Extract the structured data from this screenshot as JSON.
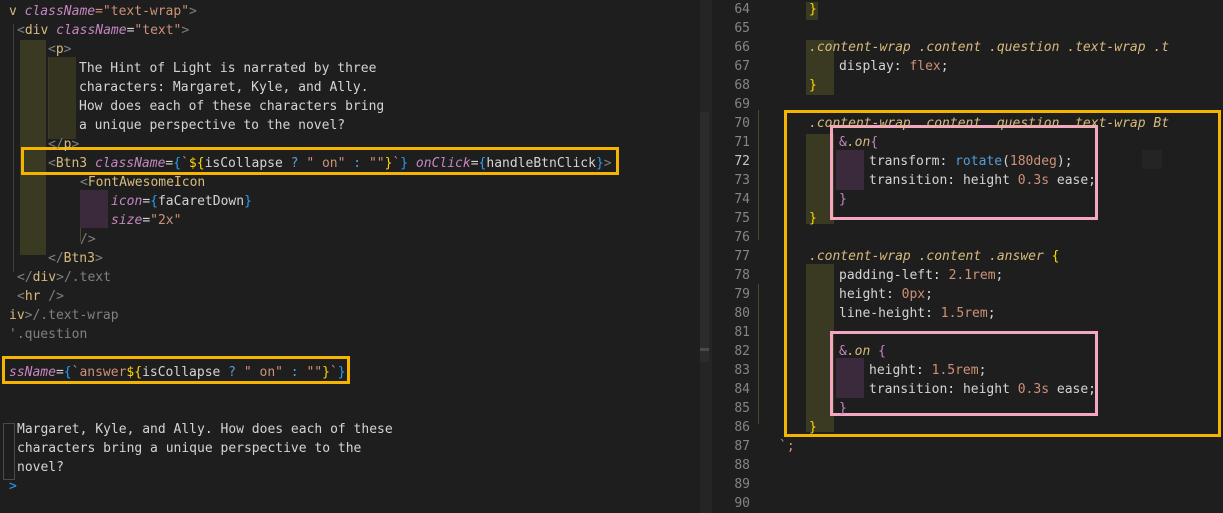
{
  "left": {
    "lines": [
      [
        {
          "t": "v ",
          "c": "tk-tag"
        },
        {
          "t": "className",
          "c": "tk-attr"
        },
        {
          "t": "=\"text-wrap\"",
          "c": "tk-str"
        },
        {
          "t": ">",
          "c": "tk-punc"
        }
      ],
      [
        {
          "t": "<",
          "c": "tk-punc"
        },
        {
          "t": "div",
          "c": "tk-tag"
        },
        {
          "t": " ",
          "c": "tk-txt"
        },
        {
          "t": "className",
          "c": "tk-attr"
        },
        {
          "t": "=",
          "c": "tk-txt"
        },
        {
          "t": "\"text\"",
          "c": "tk-str"
        },
        {
          "t": ">",
          "c": "tk-punc"
        }
      ],
      [
        {
          "t": "<",
          "c": "tk-punc"
        },
        {
          "t": "p",
          "c": "tk-tag"
        },
        {
          "t": ">",
          "c": "tk-punc"
        }
      ],
      [
        {
          "t": "The Hint of Light is narrated by three",
          "c": "tk-txt"
        }
      ],
      [
        {
          "t": "characters: Margaret, Kyle, and Ally.",
          "c": "tk-txt"
        }
      ],
      [
        {
          "t": "How does each of these characters bring",
          "c": "tk-txt"
        }
      ],
      [
        {
          "t": "a unique perspective to the novel?",
          "c": "tk-txt"
        }
      ],
      [
        {
          "t": "</",
          "c": "tk-punc"
        },
        {
          "t": "p",
          "c": "tk-tag"
        },
        {
          "t": ">",
          "c": "tk-punc"
        }
      ],
      [
        {
          "t": "<",
          "c": "tk-punc"
        },
        {
          "t": "Btn3",
          "c": "tk-tag"
        },
        {
          "t": " ",
          "c": "tk-txt"
        },
        {
          "t": "className",
          "c": "tk-attr"
        },
        {
          "t": "=",
          "c": "tk-txt"
        },
        {
          "t": "{",
          "c": "tk-br"
        },
        {
          "t": "`",
          "c": "tk-str"
        },
        {
          "t": "${",
          "c": "tk-yel"
        },
        {
          "t": "isCollapse",
          "c": "tk-txt"
        },
        {
          "t": " ? ",
          "c": "tk-kw"
        },
        {
          "t": "\" on\"",
          "c": "tk-str"
        },
        {
          "t": " : ",
          "c": "tk-kw"
        },
        {
          "t": "\"\"",
          "c": "tk-str"
        },
        {
          "t": "}",
          "c": "tk-yel"
        },
        {
          "t": "`",
          "c": "tk-str"
        },
        {
          "t": "}",
          "c": "tk-br"
        },
        {
          "t": " ",
          "c": "tk-txt"
        },
        {
          "t": "onClick",
          "c": "tk-attr"
        },
        {
          "t": "=",
          "c": "tk-txt"
        },
        {
          "t": "{",
          "c": "tk-br"
        },
        {
          "t": "handleBtnClick",
          "c": "tk-txt"
        },
        {
          "t": "}",
          "c": "tk-br"
        },
        {
          "t": ">",
          "c": "tk-punc"
        }
      ],
      [
        {
          "t": "<",
          "c": "tk-punc"
        },
        {
          "t": "FontAwesomeIcon",
          "c": "tk-tag"
        }
      ],
      [
        {
          "t": "icon",
          "c": "tk-attr"
        },
        {
          "t": "=",
          "c": "tk-txt"
        },
        {
          "t": "{",
          "c": "tk-br"
        },
        {
          "t": "faCaretDown",
          "c": "tk-txt"
        },
        {
          "t": "}",
          "c": "tk-br"
        }
      ],
      [
        {
          "t": "size",
          "c": "tk-attr"
        },
        {
          "t": "=",
          "c": "tk-txt"
        },
        {
          "t": "\"2x\"",
          "c": "tk-str"
        }
      ],
      [
        {
          "t": "/>",
          "c": "tk-punc"
        }
      ],
      [
        {
          "t": "</",
          "c": "tk-punc"
        },
        {
          "t": "Btn3",
          "c": "tk-tag"
        },
        {
          "t": ">",
          "c": "tk-punc"
        }
      ],
      [
        {
          "t": "</",
          "c": "tk-punc"
        },
        {
          "t": "div",
          "c": "tk-tag"
        },
        {
          "t": ">",
          "c": "tk-punc"
        },
        {
          "t": "/.text",
          "c": "tk-com"
        }
      ],
      [
        {
          "t": "<",
          "c": "tk-punc"
        },
        {
          "t": "hr",
          "c": "tk-tag"
        },
        {
          "t": " />",
          "c": "tk-punc"
        }
      ],
      [
        {
          "t": "iv",
          "c": "tk-tag"
        },
        {
          "t": ">",
          "c": "tk-punc"
        },
        {
          "t": "/.text-wrap",
          "c": "tk-com"
        }
      ],
      [
        {
          "t": "'.question",
          "c": "tk-com"
        }
      ],
      [
        {
          "t": "",
          "c": "tk-txt"
        }
      ],
      [
        {
          "t": "ssName",
          "c": "tk-attr"
        },
        {
          "t": "=",
          "c": "tk-txt"
        },
        {
          "t": "{",
          "c": "tk-br"
        },
        {
          "t": "`",
          "c": "tk-str"
        },
        {
          "t": "answer",
          "c": "tk-str"
        },
        {
          "t": "${",
          "c": "tk-yel"
        },
        {
          "t": "isCollapse",
          "c": "tk-txt"
        },
        {
          "t": " ? ",
          "c": "tk-kw"
        },
        {
          "t": "\" on\"",
          "c": "tk-str"
        },
        {
          "t": " : ",
          "c": "tk-kw"
        },
        {
          "t": "\"\"",
          "c": "tk-str"
        },
        {
          "t": "}",
          "c": "tk-yel"
        },
        {
          "t": "`",
          "c": "tk-str"
        },
        {
          "t": "}",
          "c": "tk-br"
        }
      ],
      [
        {
          "t": "",
          "c": "tk-txt"
        }
      ],
      [
        {
          "t": "",
          "c": "tk-txt"
        }
      ],
      [
        {
          "t": "Margaret, Kyle, and Ally. How does each of these",
          "c": "tk-txt"
        }
      ],
      [
        {
          "t": "characters bring a unique perspective to the",
          "c": "tk-txt"
        }
      ],
      [
        {
          "t": "novel?",
          "c": "tk-txt"
        }
      ],
      [
        {
          "t": ">",
          "c": "tk-br"
        }
      ]
    ]
  },
  "right": {
    "line_numbers": [
      "64",
      "65",
      "66",
      "67",
      "68",
      "69",
      "70",
      "71",
      "72",
      "73",
      "74",
      "75",
      "76",
      "77",
      "78",
      "79",
      "80",
      "81",
      "82",
      "83",
      "84",
      "85",
      "86",
      "87",
      "88",
      "89",
      "90"
    ],
    "active_line": "72",
    "lines": [
      [
        {
          "t": "}",
          "c": "tk-yel"
        }
      ],
      [],
      [
        {
          "t": ".content-wrap .content .question .text-wrap .t",
          "c": "tk-sel"
        }
      ],
      [
        {
          "t": "display",
          "c": "tk-prop"
        },
        {
          "t": ": ",
          "c": "tk-txt"
        },
        {
          "t": "flex",
          "c": "tk-num"
        },
        {
          "t": ";",
          "c": "tk-txt"
        }
      ],
      [
        {
          "t": "}",
          "c": "tk-yel"
        }
      ],
      [],
      [
        {
          "t": ".content-wrap .content .question .text-wrap Bt",
          "c": "tk-sel"
        }
      ],
      [
        {
          "t": "&",
          "c": "tk-amp"
        },
        {
          "t": ".on",
          "c": "tk-sel"
        },
        {
          "t": "{",
          "c": "tk-amp"
        }
      ],
      [
        {
          "t": "transform",
          "c": "tk-prop"
        },
        {
          "t": ": ",
          "c": "tk-txt"
        },
        {
          "t": "rotate",
          "c": "tk-kw"
        },
        {
          "t": "(",
          "c": "tk-txt"
        },
        {
          "t": "180deg",
          "c": "tk-num"
        },
        {
          "t": ");",
          "c": "tk-txt"
        }
      ],
      [
        {
          "t": "transition",
          "c": "tk-prop"
        },
        {
          "t": ": ",
          "c": "tk-txt"
        },
        {
          "t": "height",
          "c": "tk-prop"
        },
        {
          "t": " ",
          "c": "tk-txt"
        },
        {
          "t": "0.3s",
          "c": "tk-num"
        },
        {
          "t": " ease;",
          "c": "tk-txt"
        }
      ],
      [
        {
          "t": "}",
          "c": "tk-amp"
        }
      ],
      [
        {
          "t": "}",
          "c": "tk-yel"
        }
      ],
      [],
      [
        {
          "t": ".content-wrap .content .answer ",
          "c": "tk-sel"
        },
        {
          "t": "{",
          "c": "tk-yel"
        }
      ],
      [
        {
          "t": "padding-left",
          "c": "tk-prop"
        },
        {
          "t": ": ",
          "c": "tk-txt"
        },
        {
          "t": "2.1rem",
          "c": "tk-num"
        },
        {
          "t": ";",
          "c": "tk-txt"
        }
      ],
      [
        {
          "t": "height",
          "c": "tk-prop"
        },
        {
          "t": ": ",
          "c": "tk-txt"
        },
        {
          "t": "0px",
          "c": "tk-num"
        },
        {
          "t": ";",
          "c": "tk-txt"
        }
      ],
      [
        {
          "t": "line-height",
          "c": "tk-prop"
        },
        {
          "t": ": ",
          "c": "tk-txt"
        },
        {
          "t": "1.5rem",
          "c": "tk-num"
        },
        {
          "t": ";",
          "c": "tk-txt"
        }
      ],
      [],
      [
        {
          "t": "&",
          "c": "tk-amp"
        },
        {
          "t": ".on ",
          "c": "tk-sel"
        },
        {
          "t": "{",
          "c": "tk-amp"
        }
      ],
      [
        {
          "t": "height",
          "c": "tk-prop"
        },
        {
          "t": ": ",
          "c": "tk-txt"
        },
        {
          "t": "1.5rem",
          "c": "tk-num"
        },
        {
          "t": ";",
          "c": "tk-txt"
        }
      ],
      [
        {
          "t": "transition",
          "c": "tk-prop"
        },
        {
          "t": ": ",
          "c": "tk-txt"
        },
        {
          "t": "height",
          "c": "tk-prop"
        },
        {
          "t": " ",
          "c": "tk-txt"
        },
        {
          "t": "0.3s",
          "c": "tk-num"
        },
        {
          "t": " ease;",
          "c": "tk-txt"
        }
      ],
      [
        {
          "t": "}",
          "c": "tk-amp"
        }
      ],
      [
        {
          "t": "}",
          "c": "tk-yel"
        }
      ],
      [
        {
          "t": "`;",
          "c": "tk-str"
        }
      ],
      [],
      [],
      []
    ]
  },
  "colors": {
    "highlight_box": "#f5b400",
    "pink_box": "#f4a6c3",
    "background": "#1e1e1e"
  }
}
